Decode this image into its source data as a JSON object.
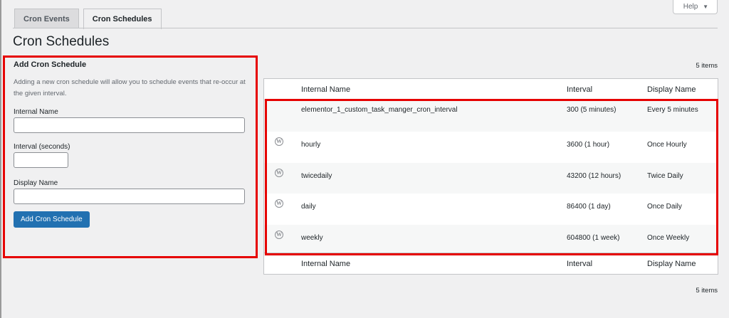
{
  "help": {
    "label": "Help",
    "caret": "▼"
  },
  "tabs": [
    {
      "label": "Cron Events",
      "active": false
    },
    {
      "label": "Cron Schedules",
      "active": true
    }
  ],
  "page_title": "Cron Schedules",
  "form": {
    "title": "Add Cron Schedule",
    "description": "Adding a new cron schedule will allow you to schedule events that re-occur at the given interval.",
    "fields": [
      {
        "label": "Internal Name",
        "value": ""
      },
      {
        "label": "Interval (seconds)",
        "value": ""
      },
      {
        "label": "Display Name",
        "value": ""
      }
    ],
    "submit_label": "Add Cron Schedule"
  },
  "items_count": "5 items",
  "table": {
    "columns": [
      "Internal Name",
      "Interval",
      "Display Name"
    ],
    "rows": [
      {
        "icon": "wordpress-icon",
        "has_icon": false,
        "name": "elementor_1_custom_task_manger_cron_interval",
        "interval": "300 (5 minutes)",
        "display": "Every 5 minutes"
      },
      {
        "icon": "wordpress-icon",
        "has_icon": true,
        "name": "hourly",
        "interval": "3600 (1 hour)",
        "display": "Once Hourly"
      },
      {
        "icon": "wordpress-icon",
        "has_icon": true,
        "name": "twicedaily",
        "interval": "43200 (12 hours)",
        "display": "Twice Daily"
      },
      {
        "icon": "wordpress-icon",
        "has_icon": true,
        "name": "daily",
        "interval": "86400 (1 day)",
        "display": "Once Daily"
      },
      {
        "icon": "wordpress-icon",
        "has_icon": true,
        "name": "weekly",
        "interval": "604800 (1 week)",
        "display": "Once Weekly"
      }
    ]
  },
  "colors": {
    "primary": "#2271b1",
    "highlight": "#e60000",
    "background": "#f0f0f1"
  }
}
